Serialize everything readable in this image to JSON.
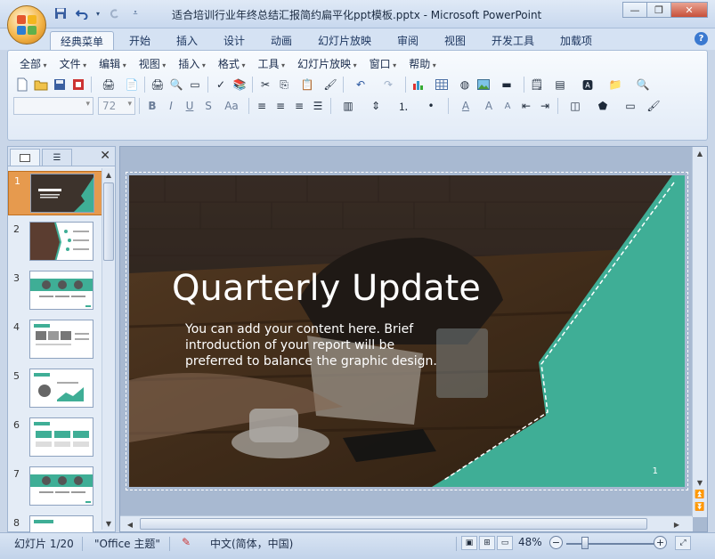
{
  "window": {
    "title": "适合培训行业年终总结汇报简约扁平化ppt模板.pptx - Microsoft PowerPoint",
    "minimize": "—",
    "restore": "❐",
    "close": "✕"
  },
  "qat": [
    "save-icon",
    "undo-icon",
    "redo-icon",
    "customize-icon"
  ],
  "tabs": [
    {
      "label": "经典菜单",
      "active": true
    },
    {
      "label": "开始"
    },
    {
      "label": "插入"
    },
    {
      "label": "设计"
    },
    {
      "label": "动画"
    },
    {
      "label": "幻灯片放映"
    },
    {
      "label": "审阅"
    },
    {
      "label": "视图"
    },
    {
      "label": "开发工具"
    },
    {
      "label": "加载项"
    }
  ],
  "help": "?",
  "menus": [
    "全部",
    "文件",
    "编辑",
    "视图",
    "插入",
    "格式",
    "工具",
    "幻灯片放映",
    "窗口",
    "帮助"
  ],
  "font": {
    "name": "",
    "size": "72"
  },
  "slides_panel": {
    "count": 8,
    "numbers": [
      "1",
      "2",
      "3",
      "4",
      "5",
      "6",
      "7",
      "8"
    ],
    "selected": "1"
  },
  "slide": {
    "title": "Quarterly Update",
    "body": "You can add your content here. Brief introduction of your report will be preferred to balance the graphic design.",
    "number": "1",
    "accent": "#3fae96"
  },
  "status": {
    "slide_info": "幻灯片 1/20",
    "theme": "\"Office 主题\"",
    "language": "中文(简体，中国)",
    "zoom": "48%",
    "zoom_minus": "−",
    "zoom_plus": "+"
  }
}
